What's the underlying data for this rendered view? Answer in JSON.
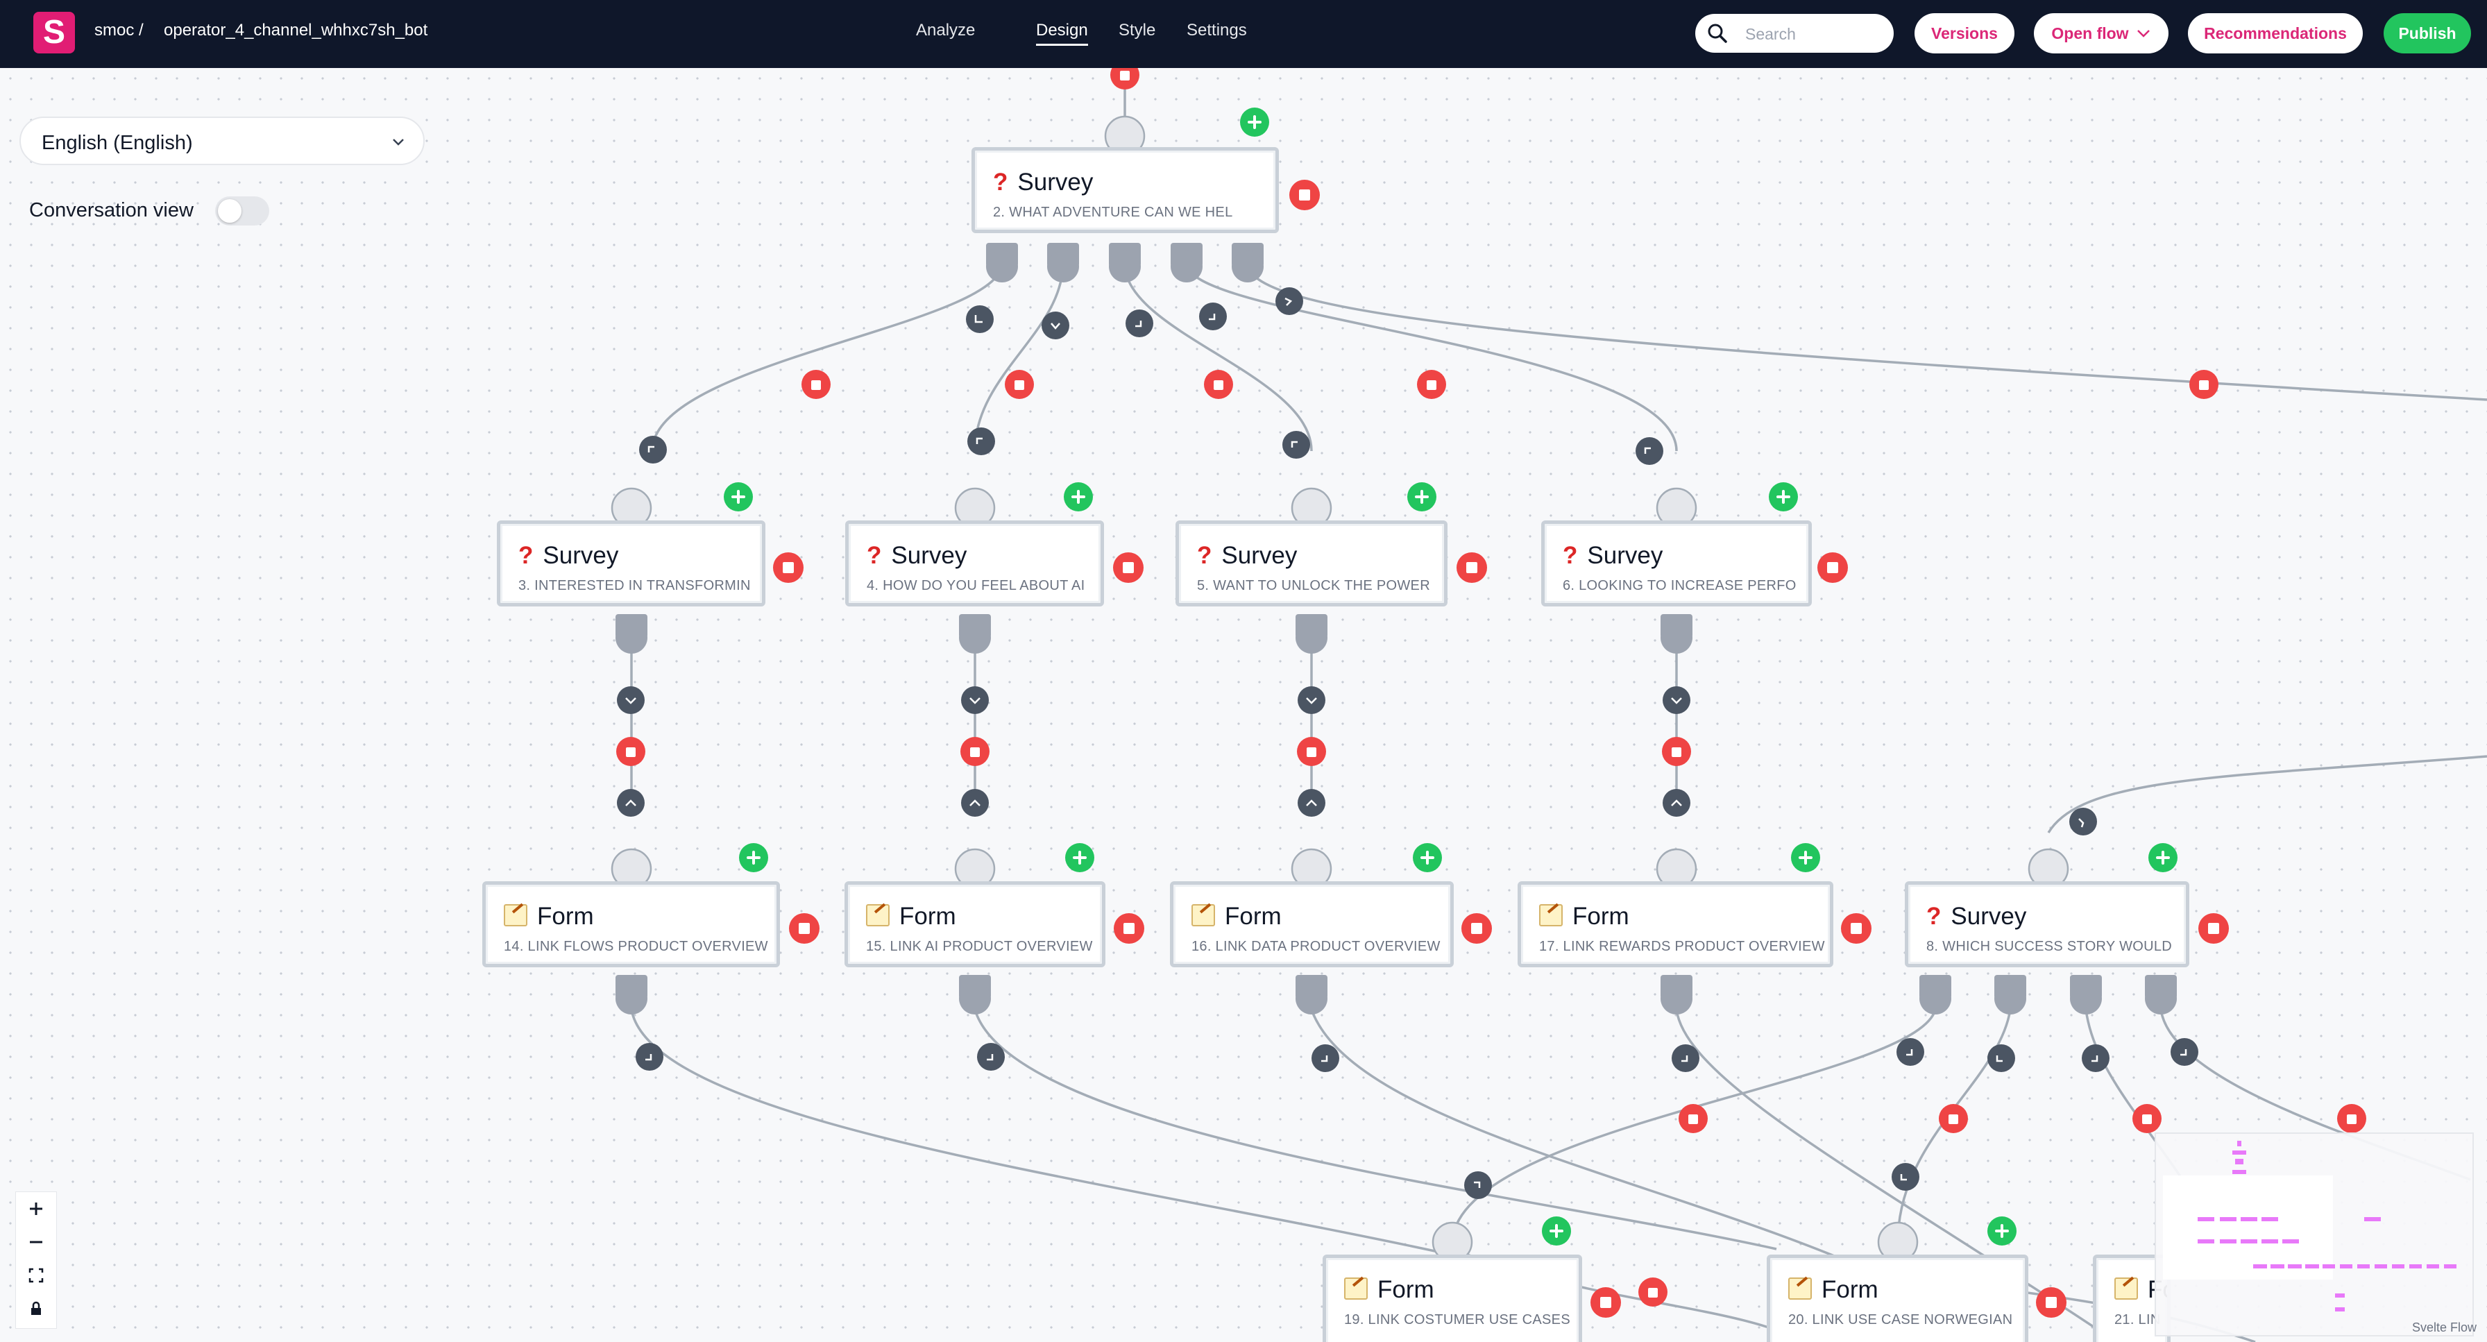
{
  "topbar": {
    "logo_letter": "S",
    "workspace": "smoc /",
    "project": "operator_4_channel_whhxc7sh_bot",
    "tabs": [
      {
        "label": "Analyze"
      },
      {
        "label": "Design",
        "active": true
      },
      {
        "label": "Style"
      },
      {
        "label": "Settings"
      }
    ],
    "search": {
      "placeholder": "Search",
      "value": ""
    },
    "buttons": {
      "versions": "Versions",
      "open_flow": "Open flow",
      "recommendations": "Recommendations",
      "publish": "Publish"
    }
  },
  "controls": {
    "language": "English (English)",
    "conversation_view_label": "Conversation view",
    "conversation_view_on": false
  },
  "nodes": [
    {
      "type": "Survey",
      "subtitle": "2. WHAT ADVENTURE CAN WE HEL"
    },
    {
      "type": "Survey",
      "subtitle": "3. INTERESTED IN TRANSFORMIN"
    },
    {
      "type": "Survey",
      "subtitle": "4. HOW DO YOU FEEL ABOUT AI"
    },
    {
      "type": "Survey",
      "subtitle": "5. WANT TO UNLOCK THE POWER"
    },
    {
      "type": "Survey",
      "subtitle": "6. LOOKING TO INCREASE PERFO"
    },
    {
      "type": "Form",
      "subtitle": "14. LINK FLOWS PRODUCT OVERVIEW"
    },
    {
      "type": "Form",
      "subtitle": "15. LINK AI PRODUCT OVERVIEW"
    },
    {
      "type": "Form",
      "subtitle": "16. LINK DATA PRODUCT OVERVIEW"
    },
    {
      "type": "Form",
      "subtitle": "17. LINK REWARDS PRODUCT OVERVIEW"
    },
    {
      "type": "Survey",
      "subtitle": "8. WHICH SUCCESS STORY WOULD"
    },
    {
      "type": "Form",
      "subtitle": "19. LINK COSTUMER USE CASES"
    },
    {
      "type": "Form",
      "subtitle": "20. LINK USE CASE NORWEGIAN"
    },
    {
      "type": "Form",
      "subtitle": "21. LIN"
    }
  ],
  "minimap_label": "Svelte Flow",
  "colors": {
    "topbar_bg": "#0f172a",
    "brand": "#e11d74",
    "accent_text": "#db2777",
    "publish": "#22c55e",
    "delete": "#ef4444",
    "add": "#22c55e",
    "edge": "#a3acb6",
    "handle": "#9ca3af",
    "edge_marker": "#4b5563"
  },
  "icons": [
    "search-icon",
    "chevron-down-icon",
    "delete-icon",
    "add-icon",
    "edge-direction-icon",
    "zoom-in-icon",
    "zoom-out-icon",
    "fit-view-icon",
    "lock-icon",
    "form-icon",
    "survey-icon"
  ]
}
